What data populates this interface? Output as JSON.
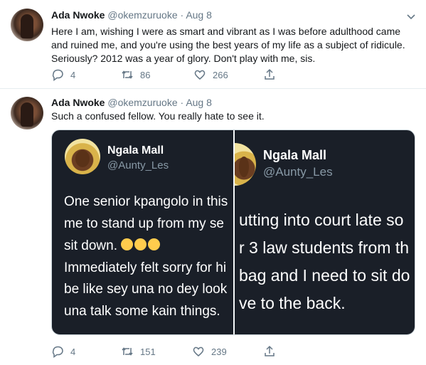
{
  "tweets": [
    {
      "name": "Ada Nwoke",
      "handle": "@okemzuruoke",
      "dot": "·",
      "date": "Aug 8",
      "text": "Here I am, wishing I were as smart and vibrant as I was before adulthood came and ruined me, and you're using the best years of my life as a subject of ridicule. Seriously? 2012 was a year of glory. Don't play with me, sis.",
      "replies": "4",
      "retweets": "86",
      "likes": "266"
    },
    {
      "name": "Ada Nwoke",
      "handle": "@okemzuruoke",
      "dot": "·",
      "date": "Aug 8",
      "text": "Such a confused fellow. You really hate to see it.",
      "replies": "4",
      "retweets": "151",
      "likes": "239"
    }
  ],
  "media": {
    "left": {
      "name": "Ngala Mall",
      "handle": "@Aunty_Les",
      "lines": [
        "One senior kpangolo in this",
        "me to stand up from my se",
        "sit down.",
        "Immediately felt sorry for hi",
        "be like sey una no dey look",
        "una talk some kain things."
      ]
    },
    "right": {
      "name": "Ngala Mall",
      "handle": "@Aunty_Les",
      "lines": [
        "utting into court late so",
        "r 3 law students from th",
        "bag and I need to sit do",
        "ve to the back."
      ]
    }
  },
  "icons": {
    "reply": "reply-icon",
    "retweet": "retweet-icon",
    "like": "like-icon",
    "share": "share-icon",
    "caret": "chevron-down-icon",
    "emoji": "laughing-emoji-icon"
  },
  "colors": {
    "text": "#14171a",
    "secondary": "#657786",
    "media_bg": "#1a1f28",
    "divider": "#e6ecf0"
  }
}
